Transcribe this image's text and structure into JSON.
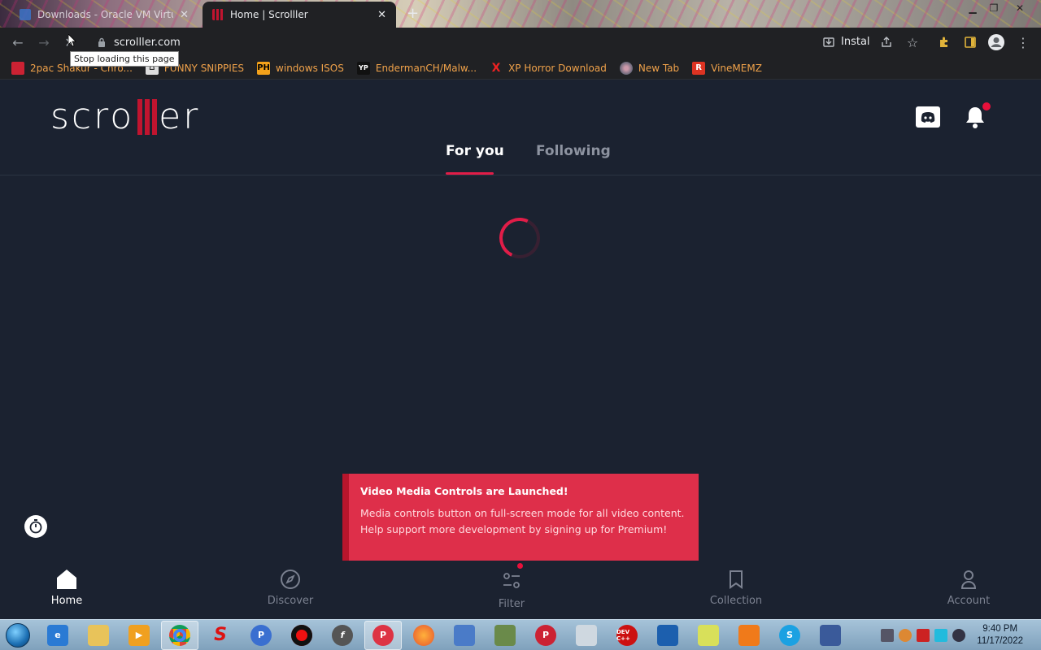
{
  "browser": {
    "tabs": [
      {
        "title": "Downloads - Oracle VM VirtualBox",
        "active": false
      },
      {
        "title": "Home | Scrolller",
        "active": true
      }
    ],
    "new_tab": "+",
    "url": "scrolller.com",
    "tooltip": "Stop loading this page",
    "install_label": "Instal",
    "bookmarks": [
      {
        "label": "2pac Shakur - Chro...",
        "icon": "calendar-icon",
        "color": "#c23"
      },
      {
        "label": "FUNNY SNIPPIES",
        "icon": "bookmark-generic-icon",
        "color": "#ddd"
      },
      {
        "label": "windows ISOS",
        "icon": "ph-icon",
        "color": "#f4a21a",
        "glyph": "PH"
      },
      {
        "label": "EndermanCH/Malw...",
        "icon": "yp-icon",
        "color": "#222",
        "glyph": "YP"
      },
      {
        "label": "XP Horror Download",
        "icon": "x-icon",
        "color": "#e22",
        "glyph": "X"
      },
      {
        "label": "New Tab",
        "icon": "globe-icon",
        "color": "#99a"
      },
      {
        "label": "VineMEMZ",
        "icon": "r-icon",
        "color": "#d32",
        "glyph": "R"
      }
    ]
  },
  "site": {
    "logo_left": "scro",
    "logo_right": "er",
    "tabs": [
      {
        "label": "For you",
        "active": true
      },
      {
        "label": "Following",
        "active": false
      }
    ],
    "toast": {
      "title": "Video Media Controls are Launched!",
      "body": "Media controls button on full-screen mode for all video content. Help support more development by signing up for Premium!"
    },
    "nav": [
      {
        "label": "Home",
        "icon": "home-icon",
        "active": true
      },
      {
        "label": "Discover",
        "icon": "compass-icon",
        "active": false
      },
      {
        "label": "Filter",
        "icon": "filter-icon",
        "active": false
      },
      {
        "label": "Collection",
        "icon": "bookmark-icon",
        "active": false
      },
      {
        "label": "Account",
        "icon": "user-icon",
        "active": false
      }
    ],
    "accent": "#e11d48"
  },
  "taskbar": {
    "clock_time": "9:40 PM",
    "clock_date": "11/17/2022",
    "apps": [
      "internet-explorer",
      "explorer",
      "media-player",
      "chrome",
      "s-app",
      "p-app",
      "recorder",
      "flash",
      "pinball",
      "firefox",
      "network",
      "games",
      "pinball2",
      "calculator",
      "dev-cpp",
      "virtualbox",
      "folder-green",
      "uc-browser",
      "skype",
      "rdp"
    ]
  }
}
